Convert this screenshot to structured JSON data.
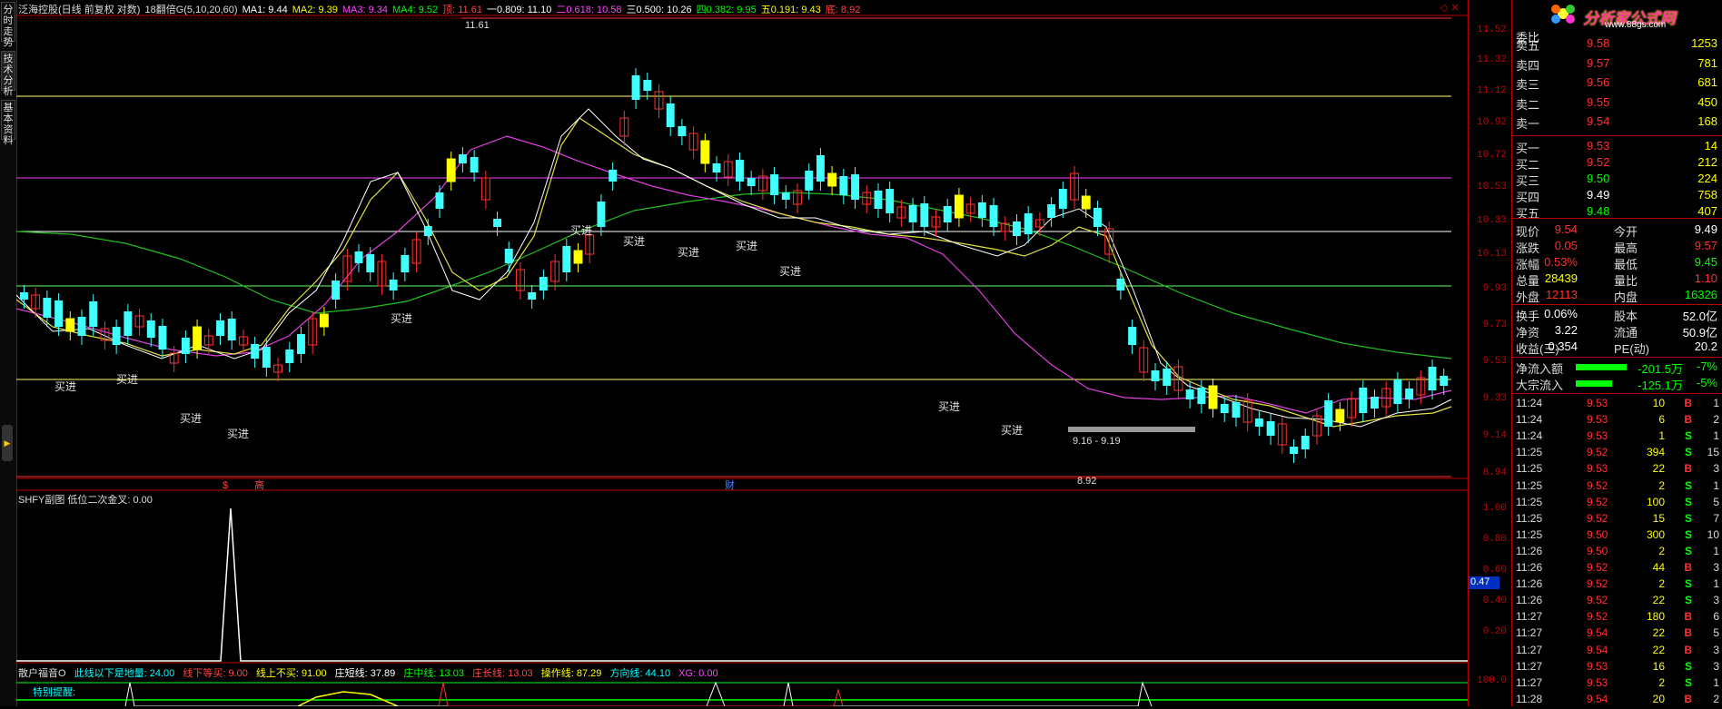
{
  "legend": {
    "stock": "泛海控股(日线 前复权 对数)",
    "period_label": "18翻倍G(5,10,20,60)",
    "ma1": "MA1: 9.44",
    "ma2": "MA2: 9.39",
    "ma3": "MA3: 9.34",
    "ma4": "MA4: 9.52",
    "fib": [
      "顶: 11.61",
      "一0.809: 11.10",
      "二0.618: 10.58",
      "三0.500: 10.26",
      "四0.382: 9.95",
      "五0.191: 9.43",
      "底: 8.92"
    ],
    "colors": {
      "ma1": "#ffffff",
      "ma2": "#ffff00",
      "ma3": "#ff40ff",
      "ma4": "#00ff00",
      "fib_top": "#ff4040",
      "fib_1": "#ffffff",
      "fib_2": "#ff40ff",
      "fib_3": "#ffffff",
      "fib_4": "#00ff00",
      "fib_5": "#ffff00",
      "fib_bot": "#ff4040"
    }
  },
  "sidetabs": [
    "分时走势",
    "技术分析",
    "基本资料"
  ],
  "main_chart": {
    "peak_label": "11.61",
    "low_label": "8.92",
    "range_label": "9.16 - 9.19",
    "buy_label": "买进",
    "event_labels": [
      "$",
      "高",
      "财"
    ]
  },
  "price_axis": [
    "11.52",
    "11.32",
    "11.12",
    "10.92",
    "10.72",
    "10.53",
    "10.33",
    "10.13",
    "9.93",
    "9.73",
    "9.53",
    "9.33",
    "9.14",
    "8.94"
  ],
  "sub1": {
    "label": "SHFY副图  低位二次金叉: 0.00",
    "axis": [
      "1.00",
      "0.80",
      "0.60",
      "0.40",
      "0.20"
    ],
    "marker": "0.47"
  },
  "sub2": {
    "name": "散户福音O",
    "items": [
      {
        "text": "此线以下是地量: 24.00",
        "color": "#00ffff"
      },
      {
        "text": "线下等买: 9.00",
        "color": "#ff4040"
      },
      {
        "text": "线上不买: 91.00",
        "color": "#ffff00"
      },
      {
        "text": "庄短线: 37.89",
        "color": "#ffffff"
      },
      {
        "text": "庄中线: 13.03",
        "color": "#00ff00"
      },
      {
        "text": "庄长线: 13.03",
        "color": "#ff4040"
      },
      {
        "text": "操作线: 87.29",
        "color": "#ffff00"
      },
      {
        "text": "方向线: 44.10",
        "color": "#00ffff"
      },
      {
        "text": "XG: 0.00",
        "color": "#ff40ff"
      }
    ],
    "tip": "特别提醒:",
    "axis": "100.0"
  },
  "logo": {
    "name": "分析家公式网",
    "url": "www.88gs.com"
  },
  "quote": {
    "weibi_label": "委比",
    "asks": [
      {
        "label": "卖五",
        "price": "9.58",
        "vol": "1253"
      },
      {
        "label": "卖四",
        "price": "9.57",
        "vol": "781"
      },
      {
        "label": "卖三",
        "price": "9.56",
        "vol": "681"
      },
      {
        "label": "卖二",
        "price": "9.55",
        "vol": "450"
      },
      {
        "label": "卖一",
        "price": "9.54",
        "vol": "168"
      }
    ],
    "bids": [
      {
        "label": "买一",
        "price": "9.53",
        "vol": "14"
      },
      {
        "label": "买二",
        "price": "9.52",
        "vol": "212"
      },
      {
        "label": "买三",
        "price": "9.50",
        "vol": "224"
      },
      {
        "label": "买四",
        "price": "9.49",
        "vol": "758"
      },
      {
        "label": "买五",
        "price": "9.48",
        "vol": "407"
      }
    ],
    "stats": [
      {
        "l1": "现价",
        "v1": "9.54",
        "l2": "今开",
        "v2": "9.49",
        "c1": "#ff3030",
        "c2": "#ffffff"
      },
      {
        "l1": "涨跌",
        "v1": "0.05",
        "l2": "最高",
        "v2": "9.57",
        "c1": "#ff3030",
        "c2": "#ff3030"
      },
      {
        "l1": "涨幅",
        "v1": "0.53%",
        "l2": "最低",
        "v2": "9.45",
        "c1": "#ff3030",
        "c2": "#00ff00"
      },
      {
        "l1": "总量",
        "v1": "28439",
        "l2": "量比",
        "v2": "1.10",
        "c1": "#ffff00",
        "c2": "#ff3030"
      },
      {
        "l1": "外盘",
        "v1": "12113",
        "l2": "内盘",
        "v2": "16326",
        "c1": "#ff3030",
        "c2": "#00ff00"
      }
    ],
    "fundamentals": [
      {
        "l1": "换手",
        "v1": "0.06%",
        "l2": "股本",
        "v2": "52.0亿"
      },
      {
        "l1": "净资",
        "v1": "3.22",
        "l2": "流通",
        "v2": "50.9亿"
      },
      {
        "l1": "收益(三)",
        "v1": "0.354",
        "l2": "PE(动)",
        "v2": "20.2"
      }
    ],
    "flows": [
      {
        "label": "净流入额",
        "value": "-201.5万",
        "pct": "-7%",
        "fill": 0.7
      },
      {
        "label": "大宗流入",
        "value": "-125.1万",
        "pct": "-5%",
        "fill": 0.5
      }
    ]
  },
  "trades": [
    {
      "t": "11:24",
      "p": "9.53",
      "v": "10",
      "bs": "B",
      "n": "1"
    },
    {
      "t": "11:24",
      "p": "9.53",
      "v": "6",
      "bs": "B",
      "n": "2"
    },
    {
      "t": "11:24",
      "p": "9.53",
      "v": "1",
      "bs": "S",
      "n": "1"
    },
    {
      "t": "11:25",
      "p": "9.52",
      "v": "394",
      "bs": "S",
      "n": "15"
    },
    {
      "t": "11:25",
      "p": "9.53",
      "v": "22",
      "bs": "B",
      "n": "3"
    },
    {
      "t": "11:25",
      "p": "9.52",
      "v": "2",
      "bs": "S",
      "n": "1"
    },
    {
      "t": "11:25",
      "p": "9.52",
      "v": "100",
      "bs": "S",
      "n": "5"
    },
    {
      "t": "11:25",
      "p": "9.52",
      "v": "15",
      "bs": "S",
      "n": "7"
    },
    {
      "t": "11:25",
      "p": "9.50",
      "v": "300",
      "bs": "S",
      "n": "10"
    },
    {
      "t": "11:26",
      "p": "9.50",
      "v": "2",
      "bs": "S",
      "n": "1"
    },
    {
      "t": "11:26",
      "p": "9.52",
      "v": "44",
      "bs": "B",
      "n": "3"
    },
    {
      "t": "11:26",
      "p": "9.52",
      "v": "2",
      "bs": "S",
      "n": "1"
    },
    {
      "t": "11:26",
      "p": "9.52",
      "v": "22",
      "bs": "S",
      "n": "3"
    },
    {
      "t": "11:27",
      "p": "9.52",
      "v": "180",
      "bs": "B",
      "n": "6"
    },
    {
      "t": "11:27",
      "p": "9.54",
      "v": "22",
      "bs": "B",
      "n": "5"
    },
    {
      "t": "11:27",
      "p": "9.54",
      "v": "22",
      "bs": "B",
      "n": "3"
    },
    {
      "t": "11:27",
      "p": "9.53",
      "v": "16",
      "bs": "S",
      "n": "3"
    },
    {
      "t": "11:27",
      "p": "9.53",
      "v": "2",
      "bs": "S",
      "n": "1"
    },
    {
      "t": "11:28",
      "p": "9.54",
      "v": "20",
      "bs": "B",
      "n": "2"
    }
  ]
}
